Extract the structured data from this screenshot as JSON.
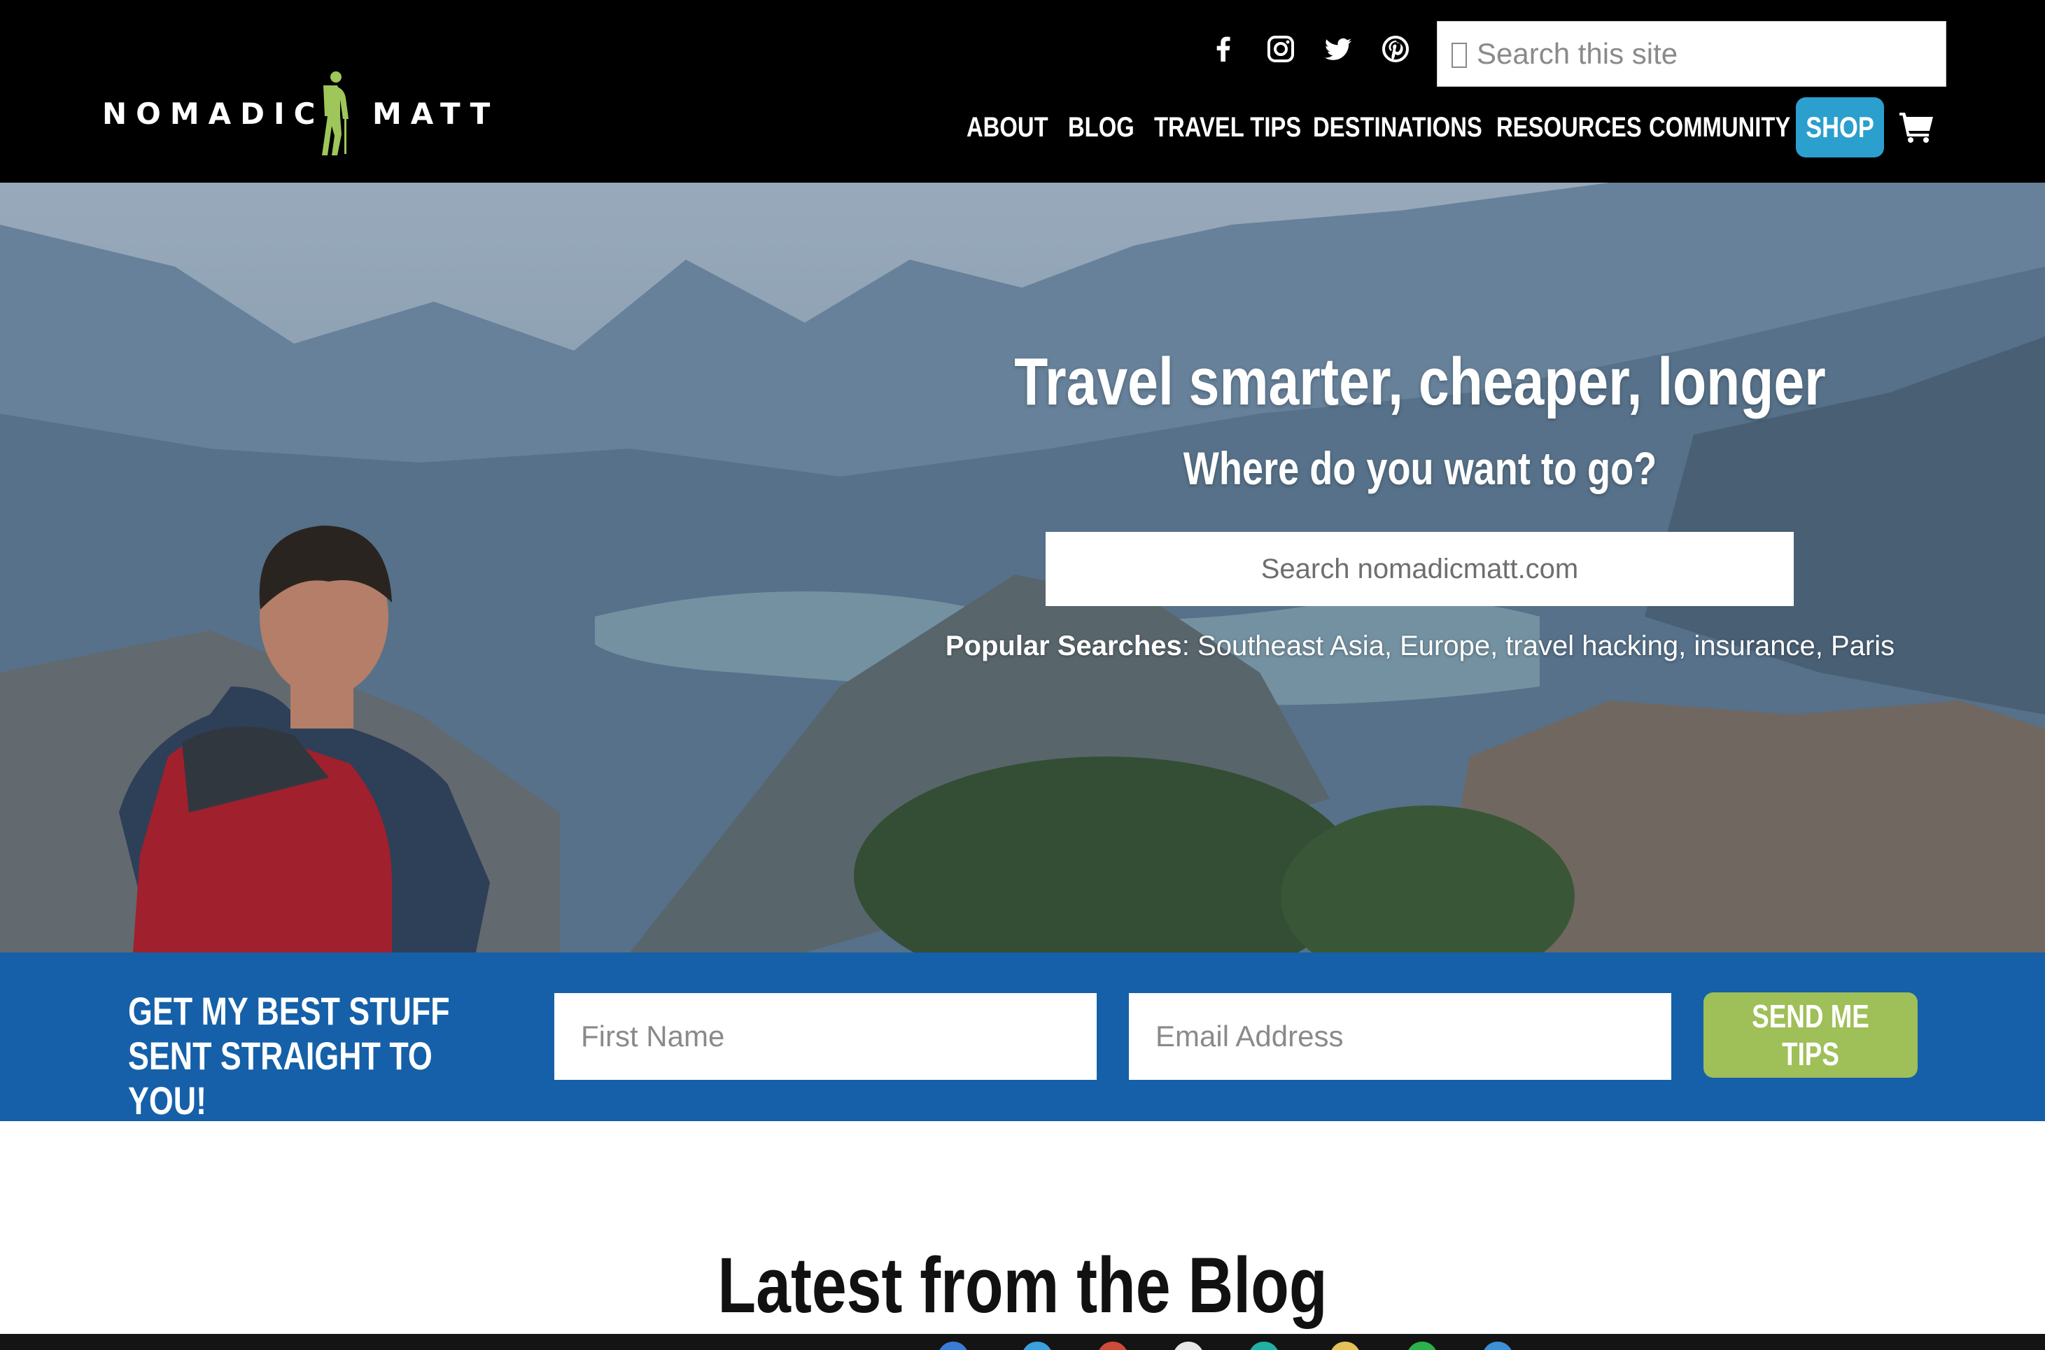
{
  "header": {
    "logo": {
      "left_word": "NOMADIC",
      "right_word": "MATT",
      "figure_color": "#9ec65a"
    },
    "social": [
      "facebook-icon",
      "instagram-icon",
      "twitter-icon",
      "pinterest-icon"
    ],
    "search": {
      "placeholder": "Search this site"
    },
    "nav": {
      "about": "ABOUT",
      "blog": "BLOG",
      "travel_tips": "TRAVEL TIPS",
      "destinations": "DESTINATIONS",
      "resources": "RESOURCES",
      "community": "COMMUNITY",
      "shop": "SHOP"
    },
    "cart_icon": "cart-icon"
  },
  "hero": {
    "title": "Travel smarter, cheaper, longer",
    "subtitle": "Where do you want to go?",
    "search_placeholder": "Search nomadicmatt.com",
    "popular_label": "Popular Searches",
    "popular_terms": "Southeast Asia, Europe, travel hacking, insurance, Paris"
  },
  "signup": {
    "heading": "GET MY BEST STUFF SENT STRAIGHT TO YOU!",
    "first_name_placeholder": "First Name",
    "email_placeholder": "Email Address",
    "button": "SEND ME TIPS"
  },
  "blog": {
    "heading": "Latest from the Blog"
  },
  "colors": {
    "header_bg": "#000000",
    "shop_accent": "#2b9fcd",
    "signup_bg": "#1560a8",
    "send_button": "#9fbf58",
    "logo_green": "#9ec65a"
  }
}
